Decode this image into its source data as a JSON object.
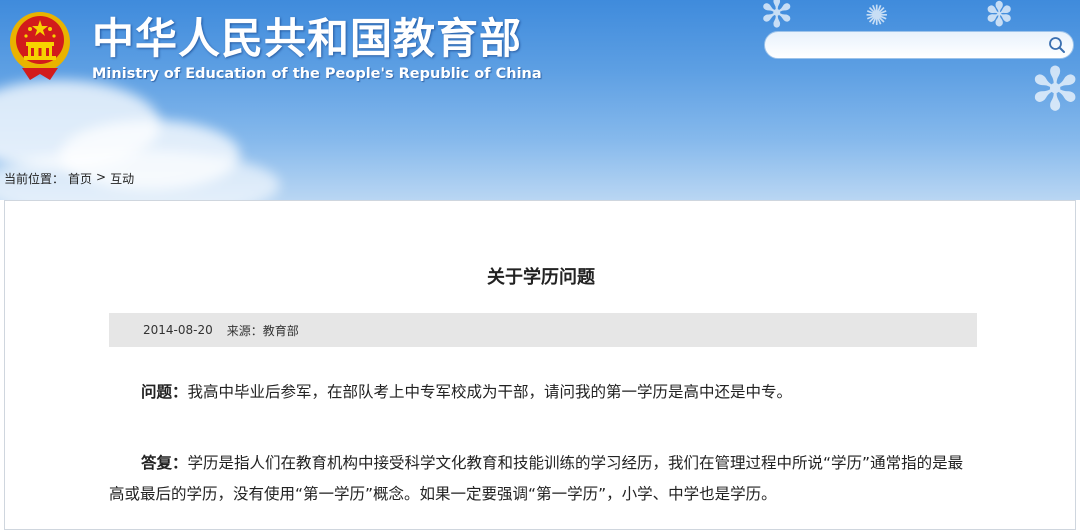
{
  "site": {
    "title_cn": "中华人民共和国教育部",
    "title_en": "Ministry of Education of the People's Republic of China"
  },
  "search": {
    "placeholder": "",
    "value": ""
  },
  "breadcrumb": {
    "prefix": "当前位置：",
    "home": "首页",
    "separator": ">",
    "current": "互动"
  },
  "article": {
    "title": "关于学历问题",
    "date": "2014-08-20",
    "source": "来源：教育部",
    "question_label": "问题：",
    "question_text": "我高中毕业后参军，在部队考上中专军校成为干部，请问我的第一学历是高中还是中专。",
    "answer_label": "答复：",
    "answer_text": "学历是指人们在教育机构中接受科学文化教育和技能训练的学习经历，我们在管理过程中所说“学历”通常指的是最高或最后的学历，没有使用“第一学历”概念。如果一定要强调“第一学历”，小学、中学也是学历。"
  },
  "colors": {
    "banner_top": "#3f8bdc",
    "banner_bottom": "#b9d6f3",
    "emblem_red": "#d21b1b",
    "emblem_gold": "#f2c200",
    "meta_bg": "#e6e6e6"
  },
  "icons": {
    "emblem": "national-emblem-icon",
    "search": "search-icon"
  }
}
